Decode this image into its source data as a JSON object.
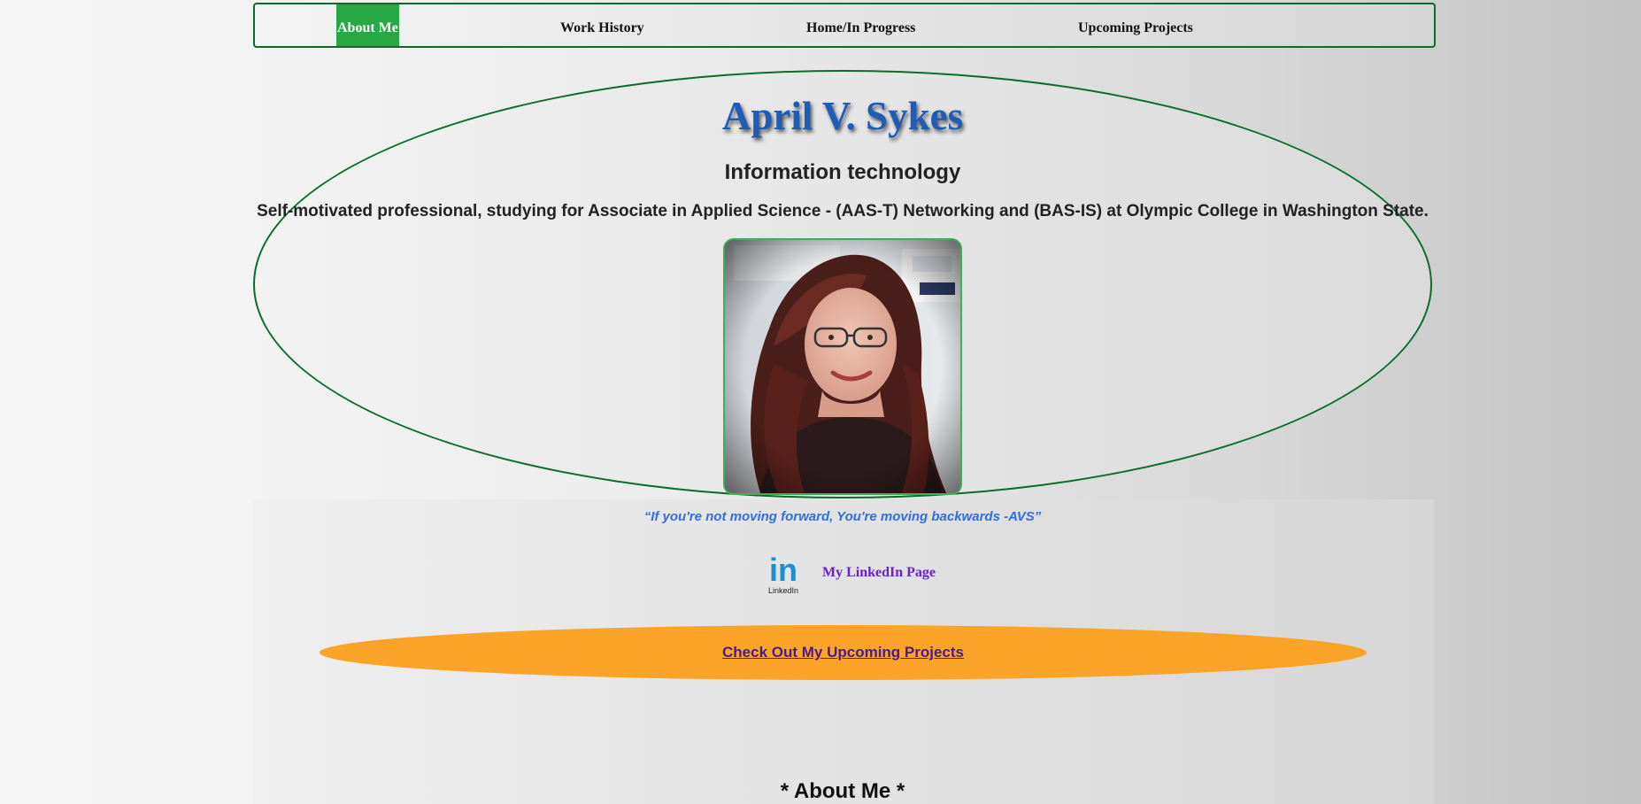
{
  "nav": {
    "items": [
      {
        "label": "About Me",
        "active": true
      },
      {
        "label": "Work History",
        "active": false
      },
      {
        "label": "Home/In Progress",
        "active": false
      },
      {
        "label": "Upcoming Projects",
        "active": false
      }
    ]
  },
  "hero": {
    "name": "April V. Sykes",
    "subtitle": "Information technology",
    "tagline": "Self-motivated professional, studying for Associate in Applied Science - (AAS-T) Networking and (BAS-IS) at Olympic College in Washington State."
  },
  "quote": "“If you're not moving forward, You're moving backwards -AVS”",
  "linkedin": {
    "logo_text": "in",
    "logo_caption": "LinkedIn",
    "link_label": "My LinkedIn Page"
  },
  "cta": {
    "label": "Check Out My Upcoming Projects"
  },
  "about": {
    "heading": "* About Me *"
  },
  "colors": {
    "border_green": "#0b6b2b",
    "active_nav": "#28a745",
    "name_blue": "#1f5cb8",
    "quote_blue": "#2f6fe0",
    "link_purple": "#6a1fc9",
    "cta_orange": "#fca32a"
  }
}
